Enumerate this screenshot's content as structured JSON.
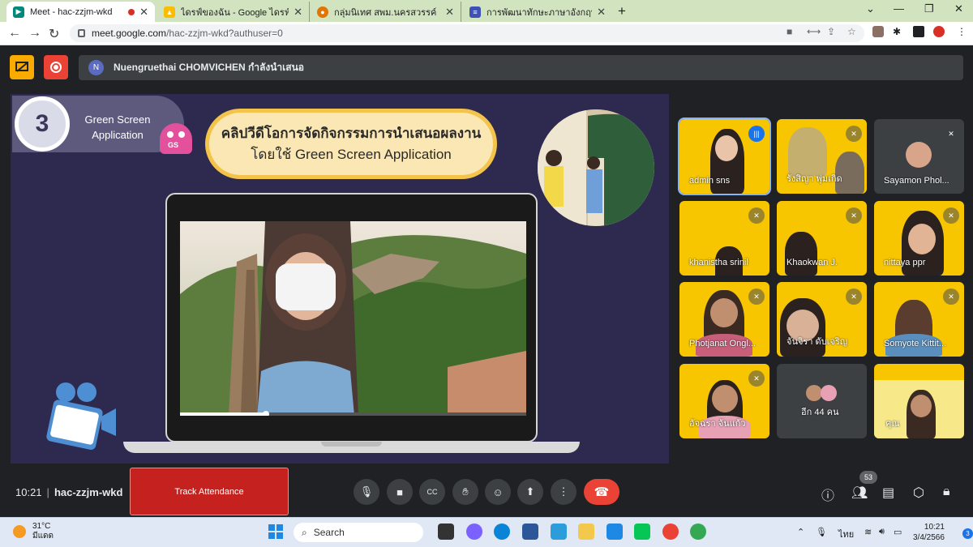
{
  "tabs": [
    {
      "label": "Meet - hac-zzjm-wkd",
      "favicon": "meet-icon",
      "color": "#00897b",
      "active": true
    },
    {
      "label": "ไดรฟ์ของฉัน - Google ไดรฟ์",
      "favicon": "drive-icon",
      "color": "#fbbc04",
      "active": false
    },
    {
      "label": "กลุ่มนิเทศ สพม.นครสวรรค์",
      "favicon": "sites-icon",
      "color": "#e37400",
      "active": false
    },
    {
      "label": "การพัฒนาทักษะภาษาอังกฤษ English",
      "favicon": "forms-icon",
      "color": "#3f51b5",
      "active": false
    }
  ],
  "address": {
    "host": "meet.google.com",
    "path": "/hac-zzjm-wkd?authuser=0"
  },
  "presenter": {
    "initial": "N",
    "text": "Nuengruethai CHOMVICHEN กำลังนำเสนอ"
  },
  "slide": {
    "step_number": "3",
    "badge_line1": "Green Screen",
    "badge_line2": "Application",
    "mascot_label": "GS",
    "title_line1": "คลิปวีดีโอการจัดกิจกรรมการนำเสนอผลงาน",
    "title_line2": "โดยใช้ Green Screen Application"
  },
  "participants": [
    {
      "name": "admin sns",
      "speaking": true
    },
    {
      "name": "รังสิญา พุ่มเกิด",
      "muted": true
    },
    {
      "name": "Sayamon Phol...",
      "muted": true
    },
    {
      "name": "khanistha srinil",
      "muted": true
    },
    {
      "name": "Khaokwan J.",
      "muted": true
    },
    {
      "name": "nittaya ppr",
      "muted": true
    },
    {
      "name": "Photjanat Ongl...",
      "muted": true
    },
    {
      "name": "จันจิรา ดับเจริญ",
      "muted": true
    },
    {
      "name": "Somyote Kittit...",
      "muted": true
    },
    {
      "name": "อัจฉรา จันแก้ว",
      "muted": true
    },
    {
      "name": "อีก 44 คน",
      "muted": false
    },
    {
      "name": "คุณ",
      "muted": false
    }
  ],
  "meeting": {
    "time": "10:21",
    "code": "hac-zzjm-wkd",
    "track_label": "Track Attendance",
    "participant_count": "53"
  },
  "taskbar": {
    "temp": "31°C",
    "weather": "มีแดด",
    "search": "Search",
    "lang": "ไทย",
    "time": "10:21",
    "date": "3/4/2566",
    "notif": "3"
  },
  "colors": {
    "meet_bg": "#202124",
    "slide_bg": "#2e2a4f",
    "end_call": "#ea4335",
    "track_btn": "#c5221f",
    "tile_yellow": "#f7c600"
  }
}
